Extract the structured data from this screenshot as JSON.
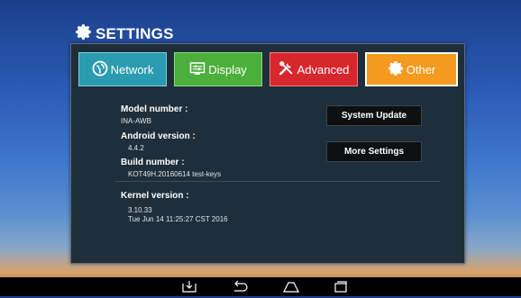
{
  "header": {
    "title": "SETTINGS",
    "icon": "gear-icon"
  },
  "tabs": [
    {
      "label": "Network",
      "icon": "globe-icon",
      "color": "#2a9bb0"
    },
    {
      "label": "Display",
      "icon": "display-icon",
      "color": "#4caf3b"
    },
    {
      "label": "Advanced",
      "icon": "tools-icon",
      "color": "#d8262d"
    },
    {
      "label": "Other",
      "icon": "gear-icon",
      "color": "#f39a1f",
      "selected": true
    }
  ],
  "info": {
    "model_label": "Model number :",
    "model_value": "INA-AWB",
    "android_label": "Android version :",
    "android_value": "4.4.2",
    "build_label": "Build number :",
    "build_value": "KOT49H.20160614 test-keys",
    "kernel_label": "Kernel version :",
    "kernel_line1": "3.10.33",
    "kernel_line2": "Tue Jun 14 11:25:27 CST 2016"
  },
  "buttons": {
    "system_update": "System Update",
    "more_settings": "More Settings"
  },
  "navbar": {
    "icons": [
      "download-icon",
      "back-icon",
      "home-icon",
      "recents-icon"
    ]
  }
}
